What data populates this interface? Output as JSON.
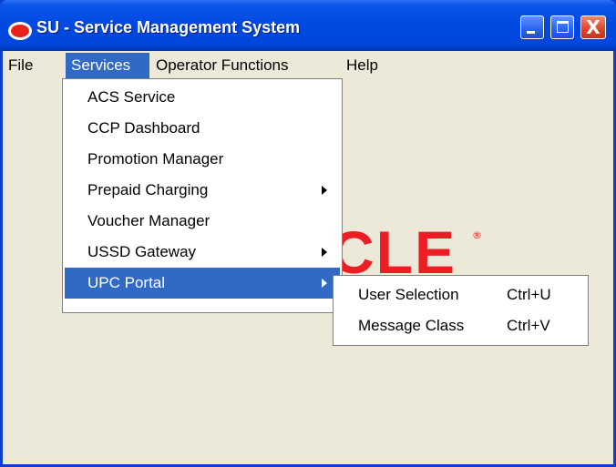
{
  "window": {
    "title": "SU - Service Management System",
    "controls": {
      "minimize_icon": "minimize-icon",
      "maximize_icon": "maximize-icon",
      "close_icon": "close-icon",
      "close_glyph": "X"
    }
  },
  "menubar": {
    "items": [
      {
        "label": "File"
      },
      {
        "label": "Services"
      },
      {
        "label": "Operator Functions"
      },
      {
        "label": "Help"
      }
    ],
    "active": "Services"
  },
  "services_menu": {
    "items": [
      {
        "label": "ACS Service",
        "submenu": false
      },
      {
        "label": "CCP Dashboard",
        "submenu": false
      },
      {
        "label": "Promotion Manager",
        "submenu": false
      },
      {
        "label": "Prepaid Charging",
        "submenu": true
      },
      {
        "label": "Voucher Manager",
        "submenu": false
      },
      {
        "label": "USSD Gateway",
        "submenu": true
      },
      {
        "label": "UPC Portal",
        "submenu": true
      }
    ],
    "highlighted": "UPC Portal"
  },
  "upc_portal_submenu": {
    "items": [
      {
        "label": "User Selection",
        "accelerator": "Ctrl+U"
      },
      {
        "label": "Message Class",
        "accelerator": "Ctrl+V"
      }
    ]
  },
  "background_logo": {
    "text": "CLE",
    "registered_mark": "®",
    "color": "#ee1d23"
  },
  "colors": {
    "titlebar": "#0048e0",
    "menu_highlight": "#316ac5",
    "client_background": "#ece9d8"
  }
}
